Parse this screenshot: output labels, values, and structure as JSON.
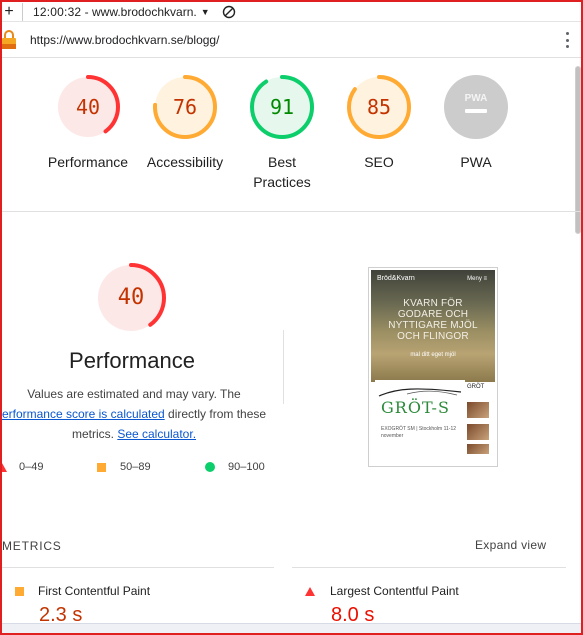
{
  "status_bar": {
    "time": "12:00:32",
    "title": "www.brodochkvarn."
  },
  "address_bar": {
    "url": "https://www.brodochkvarn.se/blogg/"
  },
  "gauges": [
    {
      "score": "40",
      "label": "Performance",
      "fraction": 0.4,
      "color": "#ff3333",
      "text_color": "#c33300",
      "fill": "#fde8e8"
    },
    {
      "score": "76",
      "label": "Accessibility",
      "fraction": 0.76,
      "color": "#ffaa33",
      "text_color": "#c33300",
      "fill": "#fff3e0"
    },
    {
      "score": "91",
      "label": "Best Practices",
      "fraction": 0.91,
      "color": "#0cce6b",
      "text_color": "#008800",
      "fill": "#e6f8ee"
    },
    {
      "score": "85",
      "label": "SEO",
      "fraction": 0.85,
      "color": "#ffaa33",
      "text_color": "#c33300",
      "fill": "#fff3e0"
    },
    {
      "score": "",
      "label": "PWA",
      "badge": "PWA",
      "color": "#cccccc"
    }
  ],
  "performance": {
    "score": "40",
    "fraction": 0.4,
    "title": "Performance",
    "desc_1": "Values are estimated and may vary. The",
    "desc_link_1": "erformance score is calculated",
    "desc_2": " directly from these",
    "desc_3": "metrics. ",
    "desc_link_2": "See calculator."
  },
  "legend": [
    {
      "shape": "triangle",
      "range": "0–49",
      "color": "#ff3333"
    },
    {
      "shape": "square",
      "range": "50–89",
      "color": "#ffaa33"
    },
    {
      "shape": "circle",
      "range": "90–100",
      "color": "#0cce6b"
    }
  ],
  "thumbnail": {
    "brand": "Bröd&Kvarn",
    "menu": "Meny ≡",
    "hero_line1": "KVARN FÖR",
    "hero_line2": "GODARE OCH",
    "hero_line3": "NYTTIGARE MJÖL",
    "hero_line4": "OCH FLINGOR",
    "hero_sub": "mal ditt eget mjöl",
    "card_title": "GRÖT-S",
    "card_meta": "EXOGRÖT SM | Stockholm 11-12 november",
    "side_title": "GRÖT"
  },
  "metrics": {
    "title": "METRICS",
    "expand": "Expand view",
    "items": [
      {
        "label": "First Contentful Paint",
        "value": "2.3 s",
        "shape": "square",
        "color": "#c33300"
      },
      {
        "label": "Largest Contentful Paint",
        "value": "8.0 s",
        "shape": "triangle",
        "color": "#eb0f00"
      }
    ]
  }
}
